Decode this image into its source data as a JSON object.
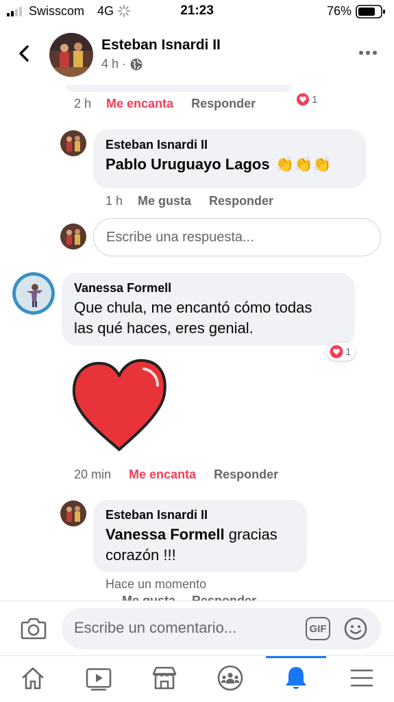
{
  "status_bar": {
    "carrier": "Swisscom",
    "network": "4G",
    "time": "21:23",
    "battery": "76%"
  },
  "header": {
    "name": "Esteban Isnardi II",
    "time_ago": "4 h",
    "separator": "·"
  },
  "top_comment_actions": {
    "time": "2 h",
    "love_label": "Me encanta",
    "reply_label": "Responder",
    "reaction_count": "1"
  },
  "reply_1": {
    "author": "Esteban Isnardi II",
    "mention": "Pablo Uruguayo Lagos",
    "emoji": "👏👏👏",
    "time": "1 h",
    "like_label": "Me gusta",
    "reply_label": "Responder"
  },
  "reply_input": {
    "placeholder": "Escribe una respuesta..."
  },
  "comment_vanessa": {
    "author": "Vanessa Formell",
    "text_line1": "Que chula, me encantó cómo todas",
    "text_line2": "las qué haces, eres genial.",
    "reaction_count": "1",
    "time": "20 min",
    "love_label": "Me encanta",
    "reply_label": "Responder"
  },
  "reply_2": {
    "author": "Esteban Isnardi II",
    "mention": "Vanessa Formell",
    "text_rest": " gracias",
    "text_line2": "corazón !!!",
    "time": "Hace un momento",
    "like_label": "Me gusta",
    "reply_label": "Responder"
  },
  "composer": {
    "placeholder": "Escribe un comentario...",
    "gif_label": "GIF"
  },
  "tabs": [
    "home-icon",
    "video-icon",
    "marketplace-icon",
    "groups-icon",
    "notifications-icon",
    "menu-icon"
  ],
  "colors": {
    "accent": "#1877f2",
    "love": "#f33e58",
    "secondary_text": "#65676b",
    "bubble": "#f0f2f5"
  }
}
